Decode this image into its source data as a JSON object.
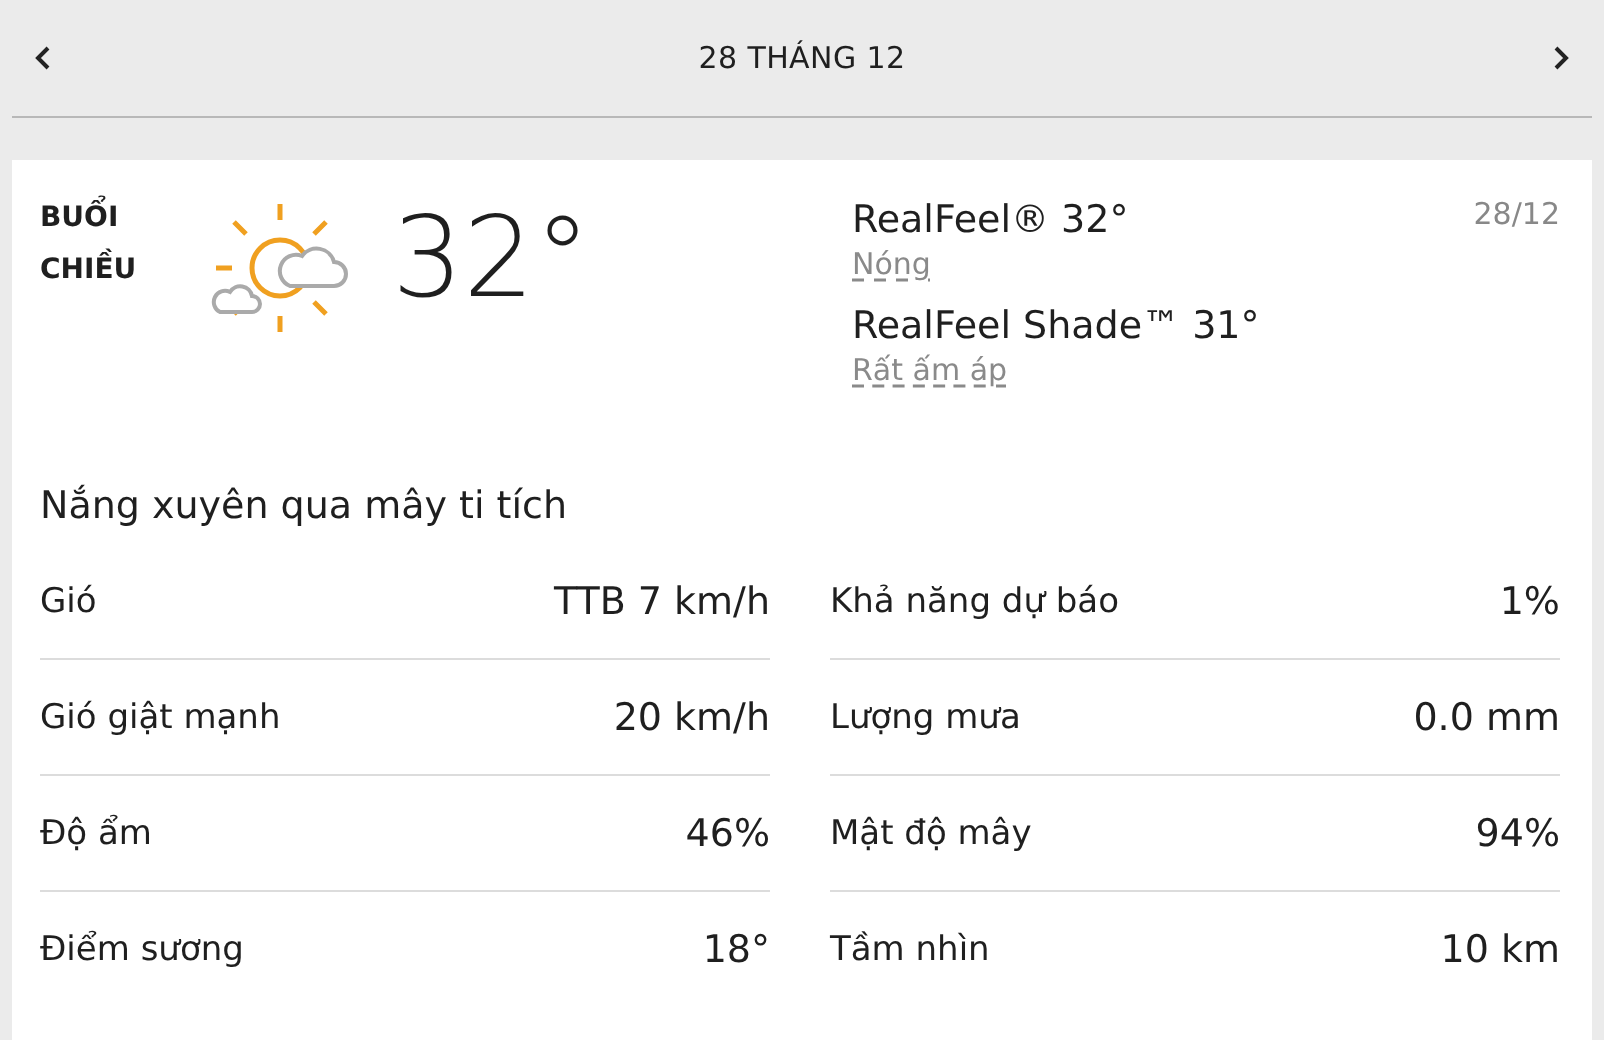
{
  "header": {
    "title": "28 THÁNG 12"
  },
  "period": {
    "label": "BUỔI CHIỀU",
    "temperature": "32°",
    "date": "28/12"
  },
  "realfeel": [
    {
      "label": "RealFeel® 32°",
      "phrase": "Nóng"
    },
    {
      "label": "RealFeel Shade™ 31°",
      "phrase": "Rất ấm áp"
    }
  ],
  "condition": "Nắng xuyên qua mây ti tích",
  "details_left": [
    {
      "label": "Gió",
      "value": "TTB 7 km/h"
    },
    {
      "label": "Gió giật mạnh",
      "value": "20 km/h"
    },
    {
      "label": "Độ ẩm",
      "value": "46%"
    },
    {
      "label": "Điểm sương",
      "value": "18°"
    }
  ],
  "details_right": [
    {
      "label": "Khả năng dự báo",
      "value": "1%"
    },
    {
      "label": "Lượng mưa",
      "value": "0.0 mm"
    },
    {
      "label": "Mật độ mây",
      "value": "94%"
    },
    {
      "label": "Tầm nhìn",
      "value": "10 km"
    }
  ]
}
